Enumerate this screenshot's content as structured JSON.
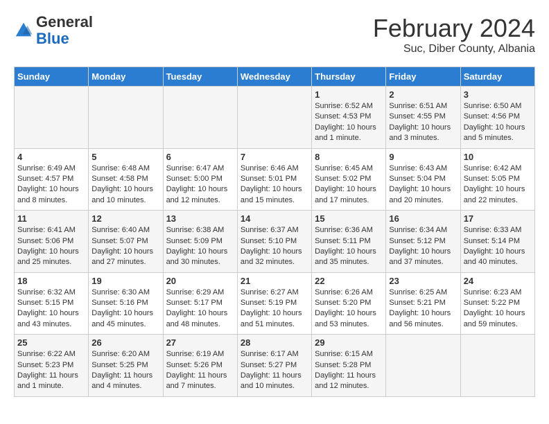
{
  "header": {
    "logo": {
      "general": "General",
      "blue": "Blue"
    },
    "title": "February 2024",
    "subtitle": "Suc, Diber County, Albania"
  },
  "calendar": {
    "weekdays": [
      "Sunday",
      "Monday",
      "Tuesday",
      "Wednesday",
      "Thursday",
      "Friday",
      "Saturday"
    ],
    "weeks": [
      [
        {
          "day": "",
          "info": ""
        },
        {
          "day": "",
          "info": ""
        },
        {
          "day": "",
          "info": ""
        },
        {
          "day": "",
          "info": ""
        },
        {
          "day": "1",
          "info": "Sunrise: 6:52 AM\nSunset: 4:53 PM\nDaylight: 10 hours and 1 minute."
        },
        {
          "day": "2",
          "info": "Sunrise: 6:51 AM\nSunset: 4:55 PM\nDaylight: 10 hours and 3 minutes."
        },
        {
          "day": "3",
          "info": "Sunrise: 6:50 AM\nSunset: 4:56 PM\nDaylight: 10 hours and 5 minutes."
        }
      ],
      [
        {
          "day": "4",
          "info": "Sunrise: 6:49 AM\nSunset: 4:57 PM\nDaylight: 10 hours and 8 minutes."
        },
        {
          "day": "5",
          "info": "Sunrise: 6:48 AM\nSunset: 4:58 PM\nDaylight: 10 hours and 10 minutes."
        },
        {
          "day": "6",
          "info": "Sunrise: 6:47 AM\nSunset: 5:00 PM\nDaylight: 10 hours and 12 minutes."
        },
        {
          "day": "7",
          "info": "Sunrise: 6:46 AM\nSunset: 5:01 PM\nDaylight: 10 hours and 15 minutes."
        },
        {
          "day": "8",
          "info": "Sunrise: 6:45 AM\nSunset: 5:02 PM\nDaylight: 10 hours and 17 minutes."
        },
        {
          "day": "9",
          "info": "Sunrise: 6:43 AM\nSunset: 5:04 PM\nDaylight: 10 hours and 20 minutes."
        },
        {
          "day": "10",
          "info": "Sunrise: 6:42 AM\nSunset: 5:05 PM\nDaylight: 10 hours and 22 minutes."
        }
      ],
      [
        {
          "day": "11",
          "info": "Sunrise: 6:41 AM\nSunset: 5:06 PM\nDaylight: 10 hours and 25 minutes."
        },
        {
          "day": "12",
          "info": "Sunrise: 6:40 AM\nSunset: 5:07 PM\nDaylight: 10 hours and 27 minutes."
        },
        {
          "day": "13",
          "info": "Sunrise: 6:38 AM\nSunset: 5:09 PM\nDaylight: 10 hours and 30 minutes."
        },
        {
          "day": "14",
          "info": "Sunrise: 6:37 AM\nSunset: 5:10 PM\nDaylight: 10 hours and 32 minutes."
        },
        {
          "day": "15",
          "info": "Sunrise: 6:36 AM\nSunset: 5:11 PM\nDaylight: 10 hours and 35 minutes."
        },
        {
          "day": "16",
          "info": "Sunrise: 6:34 AM\nSunset: 5:12 PM\nDaylight: 10 hours and 37 minutes."
        },
        {
          "day": "17",
          "info": "Sunrise: 6:33 AM\nSunset: 5:14 PM\nDaylight: 10 hours and 40 minutes."
        }
      ],
      [
        {
          "day": "18",
          "info": "Sunrise: 6:32 AM\nSunset: 5:15 PM\nDaylight: 10 hours and 43 minutes."
        },
        {
          "day": "19",
          "info": "Sunrise: 6:30 AM\nSunset: 5:16 PM\nDaylight: 10 hours and 45 minutes."
        },
        {
          "day": "20",
          "info": "Sunrise: 6:29 AM\nSunset: 5:17 PM\nDaylight: 10 hours and 48 minutes."
        },
        {
          "day": "21",
          "info": "Sunrise: 6:27 AM\nSunset: 5:19 PM\nDaylight: 10 hours and 51 minutes."
        },
        {
          "day": "22",
          "info": "Sunrise: 6:26 AM\nSunset: 5:20 PM\nDaylight: 10 hours and 53 minutes."
        },
        {
          "day": "23",
          "info": "Sunrise: 6:25 AM\nSunset: 5:21 PM\nDaylight: 10 hours and 56 minutes."
        },
        {
          "day": "24",
          "info": "Sunrise: 6:23 AM\nSunset: 5:22 PM\nDaylight: 10 hours and 59 minutes."
        }
      ],
      [
        {
          "day": "25",
          "info": "Sunrise: 6:22 AM\nSunset: 5:23 PM\nDaylight: 11 hours and 1 minute."
        },
        {
          "day": "26",
          "info": "Sunrise: 6:20 AM\nSunset: 5:25 PM\nDaylight: 11 hours and 4 minutes."
        },
        {
          "day": "27",
          "info": "Sunrise: 6:19 AM\nSunset: 5:26 PM\nDaylight: 11 hours and 7 minutes."
        },
        {
          "day": "28",
          "info": "Sunrise: 6:17 AM\nSunset: 5:27 PM\nDaylight: 11 hours and 10 minutes."
        },
        {
          "day": "29",
          "info": "Sunrise: 6:15 AM\nSunset: 5:28 PM\nDaylight: 11 hours and 12 minutes."
        },
        {
          "day": "",
          "info": ""
        },
        {
          "day": "",
          "info": ""
        }
      ]
    ]
  }
}
